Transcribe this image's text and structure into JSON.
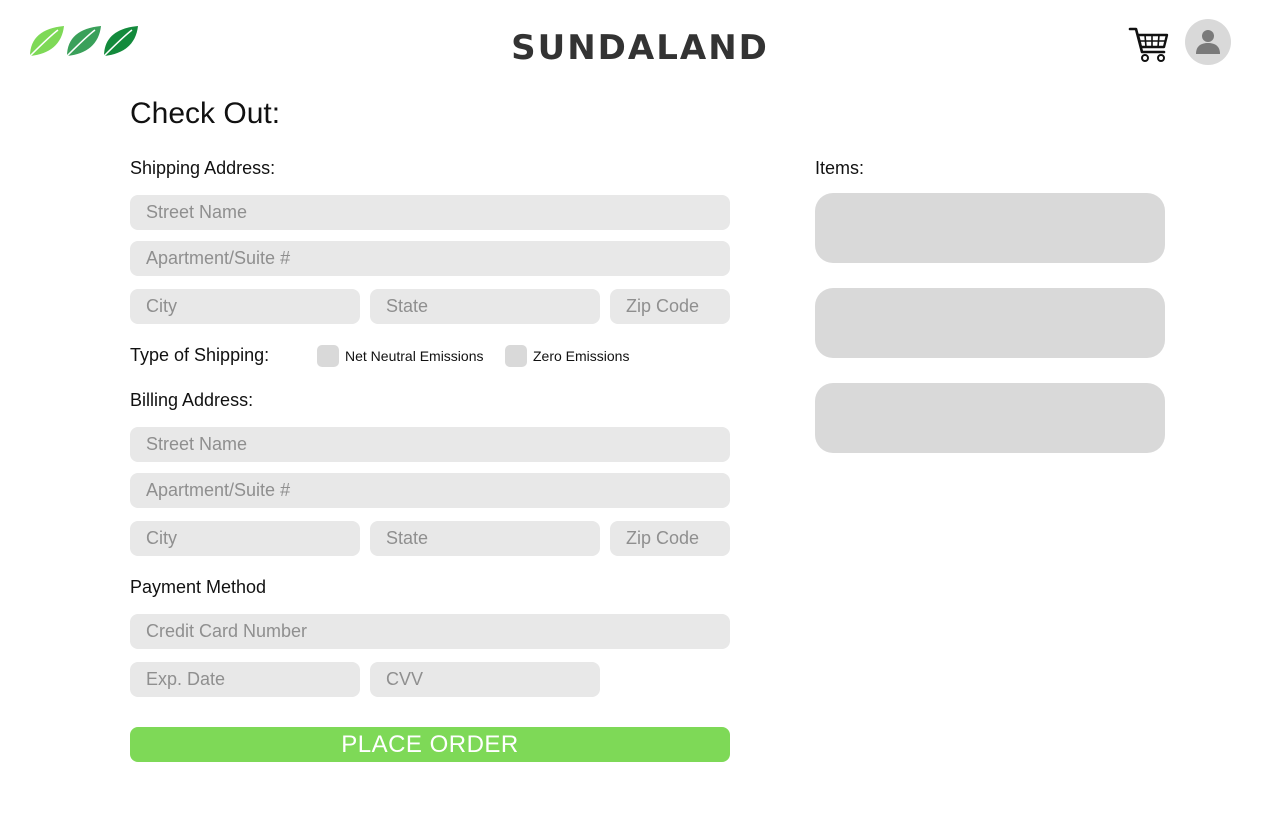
{
  "header": {
    "logo_icon": "three-leaves-logo",
    "brand": "SUNDALAND",
    "cart_icon": "shopping-cart-icon",
    "avatar_icon": "user-avatar-icon"
  },
  "page_title": "Check Out:",
  "shipping": {
    "section_label": "Shipping Address:",
    "street_placeholder": "Street Name",
    "apt_placeholder": "Apartment/Suite #",
    "city_placeholder": "City",
    "state_placeholder": "State",
    "zip_placeholder": "Zip Code"
  },
  "shipping_type": {
    "label": "Type of Shipping:",
    "options": [
      {
        "label": "Net Neutral Emissions",
        "checked": false
      },
      {
        "label": "Zero Emissions",
        "checked": false
      }
    ]
  },
  "billing": {
    "section_label": "Billing Address:",
    "street_placeholder": "Street Name",
    "apt_placeholder": "Apartment/Suite #",
    "city_placeholder": "City",
    "state_placeholder": "State",
    "zip_placeholder": "Zip Code"
  },
  "payment": {
    "section_label": "Payment Method",
    "card_placeholder": "Credit Card Number",
    "exp_placeholder": "Exp. Date",
    "cvv_placeholder": "CVV"
  },
  "place_order_label": "PLACE ORDER",
  "items": {
    "label": "Items:",
    "count": 3
  },
  "colors": {
    "accent": "#7ed957",
    "field_bg": "#e8e8e8",
    "card_bg": "#d9d9d9",
    "leaf_light": "#7ed957",
    "leaf_mid": "#3aa05a",
    "leaf_dark": "#138a3c"
  }
}
